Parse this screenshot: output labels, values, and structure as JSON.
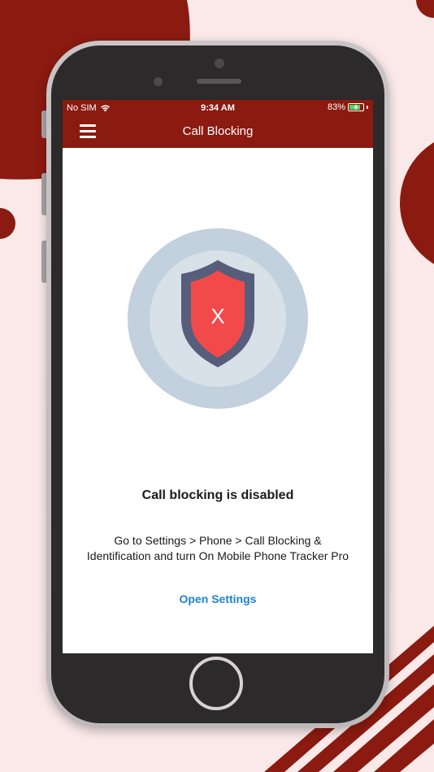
{
  "status_bar": {
    "carrier": "No SIM",
    "time": "9:34 AM",
    "battery_percent": "83%",
    "battery_level": 0.83
  },
  "nav": {
    "title": "Call Blocking",
    "menu_icon": "hamburger-menu-icon"
  },
  "content": {
    "shield_icon": "shield-x-icon",
    "shield_mark": "X",
    "title": "Call blocking is disabled",
    "description_line1": "Go to Settings > Phone > Call Blocking &",
    "description_line2": "Identification and turn On Mobile Phone Tracker Pro",
    "action_label": "Open Settings"
  },
  "colors": {
    "brand": "#8b1a10",
    "link": "#1d82d3",
    "background": "#fbe9e9",
    "shield_fill": "#f24a4a",
    "shield_border": "#575e7c",
    "battery": "#4cd964"
  }
}
